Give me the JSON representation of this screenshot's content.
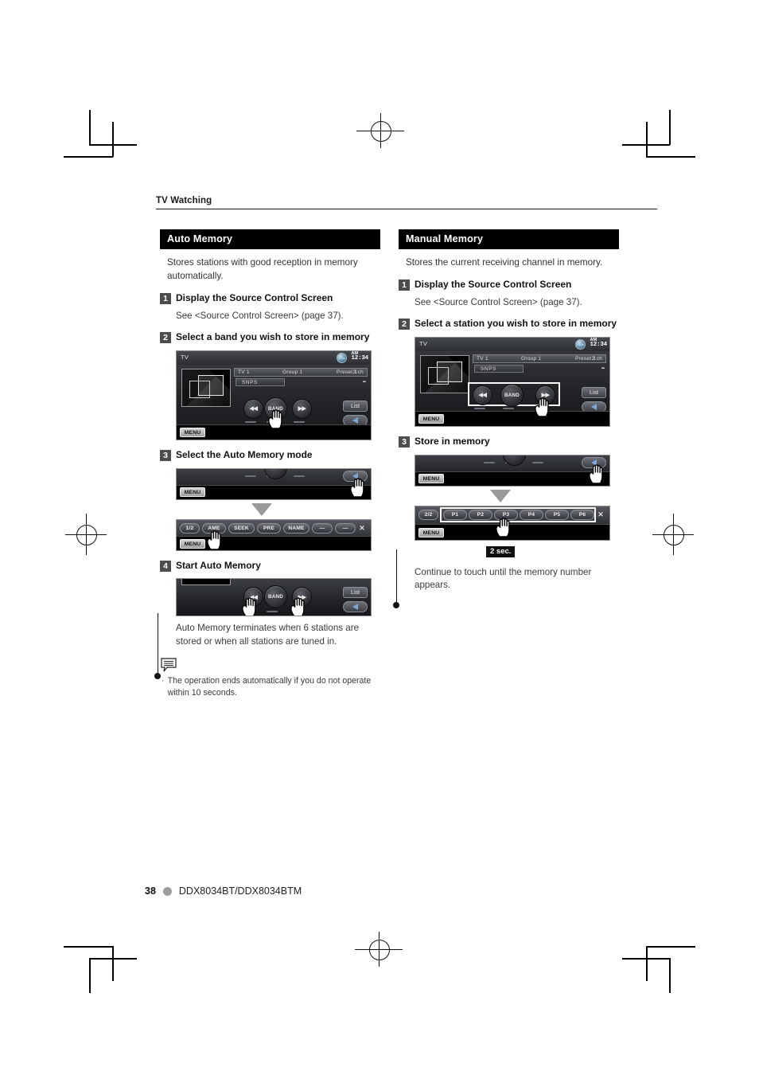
{
  "page": {
    "running_header": "TV Watching",
    "footer_page_number": "38",
    "footer_model": "DDX8034BT/DDX8034BTM"
  },
  "left_column": {
    "section_title": "Auto Memory",
    "intro": "Stores stations with good reception in memory automatically.",
    "steps": [
      {
        "num": "1",
        "label": "Display the Source Control Screen",
        "detail": "See <Source Control Screen> (page 37)."
      },
      {
        "num": "2",
        "label": "Select a band you wish to store in memory"
      },
      {
        "num": "3",
        "label": "Select the Auto Memory mode"
      },
      {
        "num": "4",
        "label": "Start Auto Memory"
      }
    ],
    "caption": "Auto Memory terminates when 6 stations are stored or when all stations are tuned in.",
    "note": "The operation ends automatically if you do not operate within 10 seconds.",
    "note_bullet": "·",
    "function_buttons": [
      "1/2",
      "AME",
      "SEEK",
      "PRE",
      "NAME",
      "—",
      "—"
    ],
    "close_icon_label": "✕"
  },
  "right_column": {
    "section_title": "Manual Memory",
    "intro": "Stores the current receiving channel in memory.",
    "steps": [
      {
        "num": "1",
        "label": "Display the Source Control Screen",
        "detail": "See <Source Control Screen> (page 37)."
      },
      {
        "num": "2",
        "label": "Select a station you wish to store in memory"
      },
      {
        "num": "3",
        "label": "Store in memory"
      }
    ],
    "hold_badge": "2 sec.",
    "caption": "Continue to touch until the memory number appears.",
    "preset_buttons": [
      "2/2",
      "P1",
      "P2",
      "P3",
      "P4",
      "P5",
      "P6"
    ],
    "close_icon_label": "✕"
  },
  "device_screen": {
    "source_label": "TV",
    "clock_ampm": "AM",
    "clock_time": "12:34",
    "info": {
      "tuner": "TV 1",
      "group": "Group 1",
      "preset": "Preset 1",
      "channel": "2 ch"
    },
    "station_name": "SNPS",
    "transport": {
      "prev": "◀◀",
      "band": "BAND",
      "next": "▶▶"
    },
    "list_label": "List",
    "menu_label": "MENU"
  },
  "colors": {
    "section_header_bg": "#000000",
    "step_number_bg": "#4d4d4d",
    "body_text": "#333333",
    "footer_dot": "#9d9d9d",
    "highlight_border": "#ffffff"
  }
}
